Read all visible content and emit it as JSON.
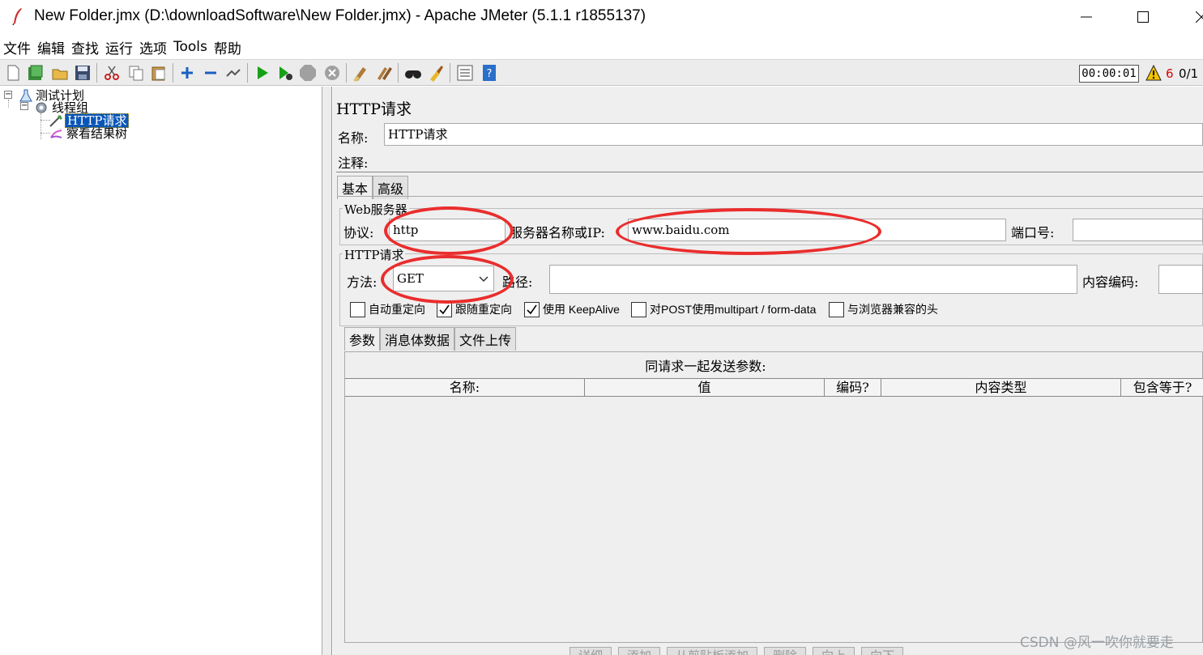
{
  "window": {
    "title": "New Folder.jmx (D:\\downloadSoftware\\New Folder.jmx) - Apache JMeter (5.1.1 r1855137)"
  },
  "menu": [
    "文件",
    "编辑",
    "查找",
    "运行",
    "选项",
    "Tools",
    "帮助"
  ],
  "toolbar": {
    "icons": [
      "new-icon",
      "templates-icon",
      "open-icon",
      "save-icon",
      "cut-icon",
      "copy-icon",
      "paste-icon",
      "expand-icon",
      "collapse-icon",
      "toggle-icon",
      "start-icon",
      "start-no-pause-icon",
      "stop-icon",
      "shutdown-icon",
      "clear-icon",
      "clear-all-icon",
      "search-icon",
      "reset-search-icon",
      "function-helper-icon",
      "help-icon"
    ],
    "timer": "00:00:01",
    "warning_count": "6",
    "thread_count": "0/1"
  },
  "tree": {
    "items": [
      {
        "label": "测试计划"
      },
      {
        "label": "线程组"
      },
      {
        "label": "HTTP请求"
      },
      {
        "label": "察看结果树"
      }
    ]
  },
  "panel": {
    "title": "HTTP请求",
    "name_label": "名称:",
    "name_value": "HTTP请求",
    "comment_label": "注释:",
    "comment_value": "",
    "tabs": [
      "基本",
      "高级"
    ],
    "web_server": {
      "group_title": "Web服务器",
      "protocol_label": "协议:",
      "protocol_value": "http",
      "server_label": "服务器名称或IP:",
      "server_value": "www.baidu.com",
      "port_label": "端口号:",
      "port_value": ""
    },
    "http_request": {
      "group_title": "HTTP请求",
      "method_label": "方法:",
      "method_value": "GET",
      "path_label": "路径:",
      "path_value": "",
      "encoding_label": "内容编码:",
      "encoding_value": ""
    },
    "checkboxes": [
      {
        "label": "自动重定向",
        "checked": false
      },
      {
        "label": "跟随重定向",
        "checked": true
      },
      {
        "label": "使用 KeepAlive",
        "checked": true
      },
      {
        "label": "对POST使用multipart / form-data",
        "checked": false
      },
      {
        "label": "与浏览器兼容的头",
        "checked": false
      }
    ],
    "sub_tabs": [
      "参数",
      "消息体数据",
      "文件上传"
    ],
    "params_caption": "同请求一起发送参数:",
    "columns": [
      "名称:",
      "值",
      "编码?",
      "内容类型",
      "包含等于?"
    ],
    "buttons": [
      "详细",
      "添加",
      "从剪贴板添加",
      "删除",
      "向上",
      "向下"
    ]
  },
  "colors": {
    "selection": "#0a56b8",
    "annotation": "#ea2d2d",
    "warning": "#e00000"
  },
  "watermark": "CSDN @风一吹你就要走"
}
